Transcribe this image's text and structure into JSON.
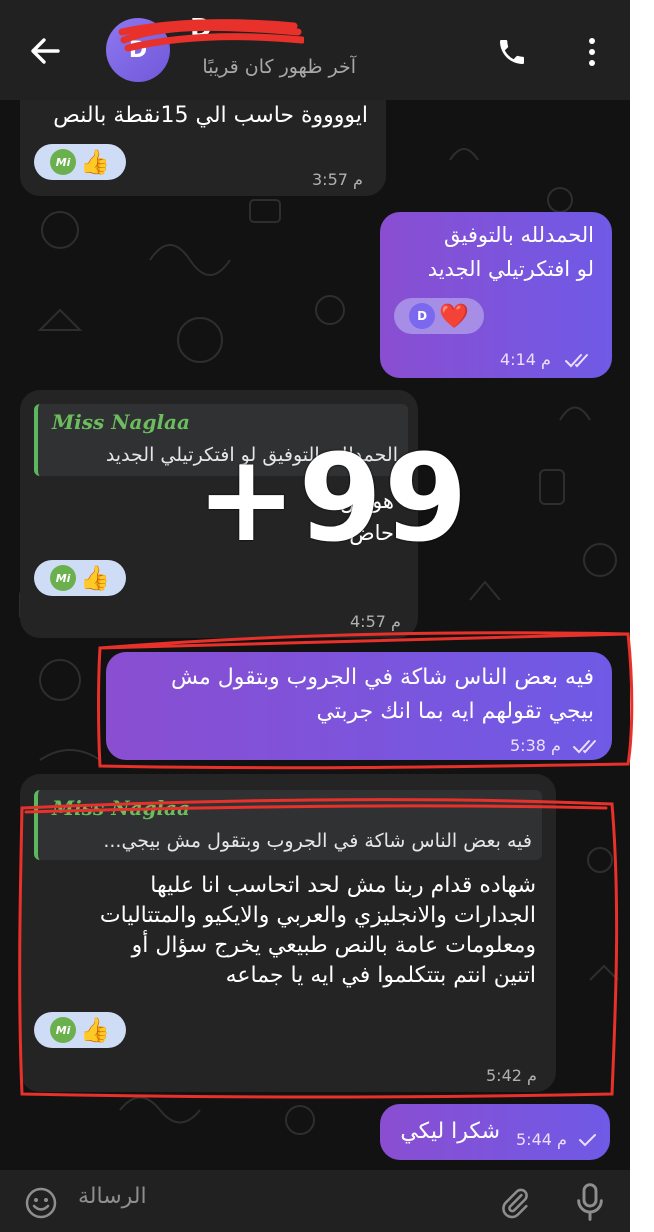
{
  "header": {
    "contact_name": "D",
    "avatar_letter": "D",
    "last_seen": "آخر ظهور كان قريبًا",
    "icons": [
      "back-arrow-icon",
      "phone-icon",
      "more-vert-icon"
    ]
  },
  "messages": [
    {
      "direction": "incoming",
      "text": "ايووووة حاسب الي 15نقطة بالنص",
      "reactions": [
        "👍",
        "Mi"
      ],
      "time": "3:57 م"
    },
    {
      "direction": "outgoing",
      "lines": [
        "الحمدلله بالتوفيق",
        "لو افتكرتيلي الجديد"
      ],
      "reactions": [
        "❤️",
        "D"
      ],
      "time": "4:14 م",
      "status": "read"
    },
    {
      "direction": "incoming",
      "quote_author": "Miss Naglaa",
      "quote_text": "الحمدلله بالتوفيق  لو افتكرتيلي الجديد",
      "lines": [
        "هو ص",
        "حاض"
      ],
      "reactions": [
        "👍",
        "Mi"
      ],
      "time": "4:57 م"
    },
    {
      "direction": "outgoing",
      "lines": [
        "فيه بعض الناس شاكة في الجروب وبتقول مش",
        "بيجي تقولهم ايه بما انك جربتي"
      ],
      "time": "5:38 م",
      "status": "read"
    },
    {
      "direction": "incoming",
      "quote_author": "Miss Naglaa",
      "quote_text": "فيه بعض الناس شاكة في الجروب وبتقول مش بيجي...",
      "lines": [
        "شهاده قدام ربنا مش لحد اتحاسب انا عليها",
        "الجدارات والانجليزي والعربي والايكيو والمتتاليات",
        "ومعلومات عامة بالنص طبيعي يخرج سؤال أو",
        "اتنين انتم بتتكلموا في ايه يا جماعه"
      ],
      "reactions": [
        "👍",
        "Mi"
      ],
      "time": "5:42 م"
    },
    {
      "direction": "outgoing",
      "text": "شكرا ليكي",
      "time": "5:44 م",
      "status": "sent"
    }
  ],
  "overlay_text": "+99",
  "input": {
    "placeholder": "الرسالة",
    "icons": [
      "emoji-icon",
      "attach-icon",
      "mic-icon"
    ]
  },
  "colors": {
    "outgoing_bubble": "#7b55e0",
    "incoming_bubble": "#242424",
    "background": "#121213",
    "annotation_red": "#e8312a",
    "quote_green": "#6cbd5d"
  }
}
